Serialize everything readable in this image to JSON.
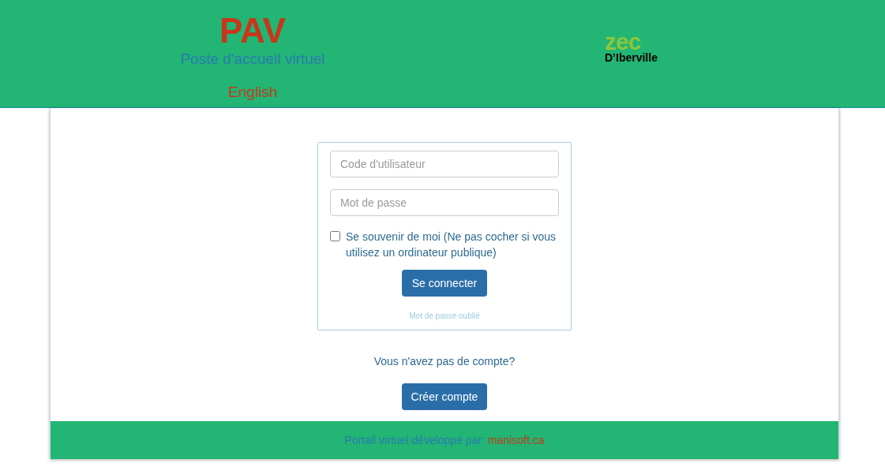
{
  "header": {
    "title": "PAV",
    "subtitle": "Poste d'accueil virtuel",
    "language_link": "English",
    "logo": {
      "mark": "zec",
      "name": "D’Iberville"
    }
  },
  "login": {
    "username": {
      "placeholder": "Code d'utilisateur"
    },
    "password": {
      "placeholder": "Mot de passe"
    },
    "remember": {
      "label": "Se souvenir de moi (Ne pas cocher si vous utilisez un ordinateur publique)",
      "checked": false
    },
    "submit": "Se connecter",
    "forgot": "Mot de passe oublié"
  },
  "signup": {
    "prompt": "Vous n'avez pas de compte?",
    "button": "Créer compte"
  },
  "footer": {
    "text": "Portail virtuel développé par:",
    "link": "manisoft.ca"
  }
}
